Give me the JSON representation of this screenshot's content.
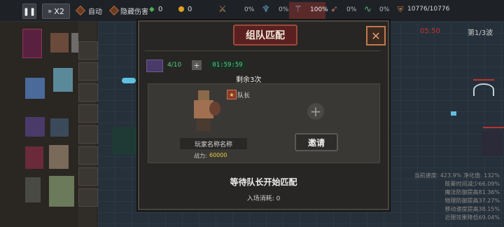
{
  "topbar": {
    "pause_icon": "pause-icon",
    "speed_label": "X2",
    "auto_label": "自动",
    "hide_damage_label": "隐藏伤害",
    "gem_count": "0",
    "gold_count": "0",
    "skills": [
      {
        "icon": "sword-icon",
        "pct": "0%"
      },
      {
        "icon": "spirit-icon",
        "pct": "0%"
      },
      {
        "icon": "claw-icon",
        "pct": "100%"
      },
      {
        "icon": "archer-icon",
        "pct": "0%"
      },
      {
        "icon": "serpent-icon",
        "pct": "0%"
      }
    ],
    "hp": "10776/10776"
  },
  "hud": {
    "timer": "05:50",
    "wave": "第1/3波"
  },
  "dialog": {
    "title": "组队匹配",
    "member_count": "4/10",
    "countdown": "01:59:59",
    "remaining": "剩余3次",
    "captain_label": "队长",
    "player_name": "玩家名称名称",
    "power_label": "战力:",
    "power_value": "60000",
    "invite_label": "邀请",
    "waiting_text": "等待队长开始匹配",
    "entry_cost": "入场消耗: 0"
  },
  "stats": [
    "当前速度: 423.9%  净化值: 132%",
    "眩晕时间减少66.09%",
    "魔法防御提高81.36%",
    "物理防御提高37.27%",
    "移动速度提高38.15%",
    "近眼效果降低69.04%"
  ],
  "colors": {
    "accent_red": "#c03030",
    "countdown_green": "#50d080",
    "power_yellow": "#e8d040",
    "title_red": "#5a2020"
  }
}
